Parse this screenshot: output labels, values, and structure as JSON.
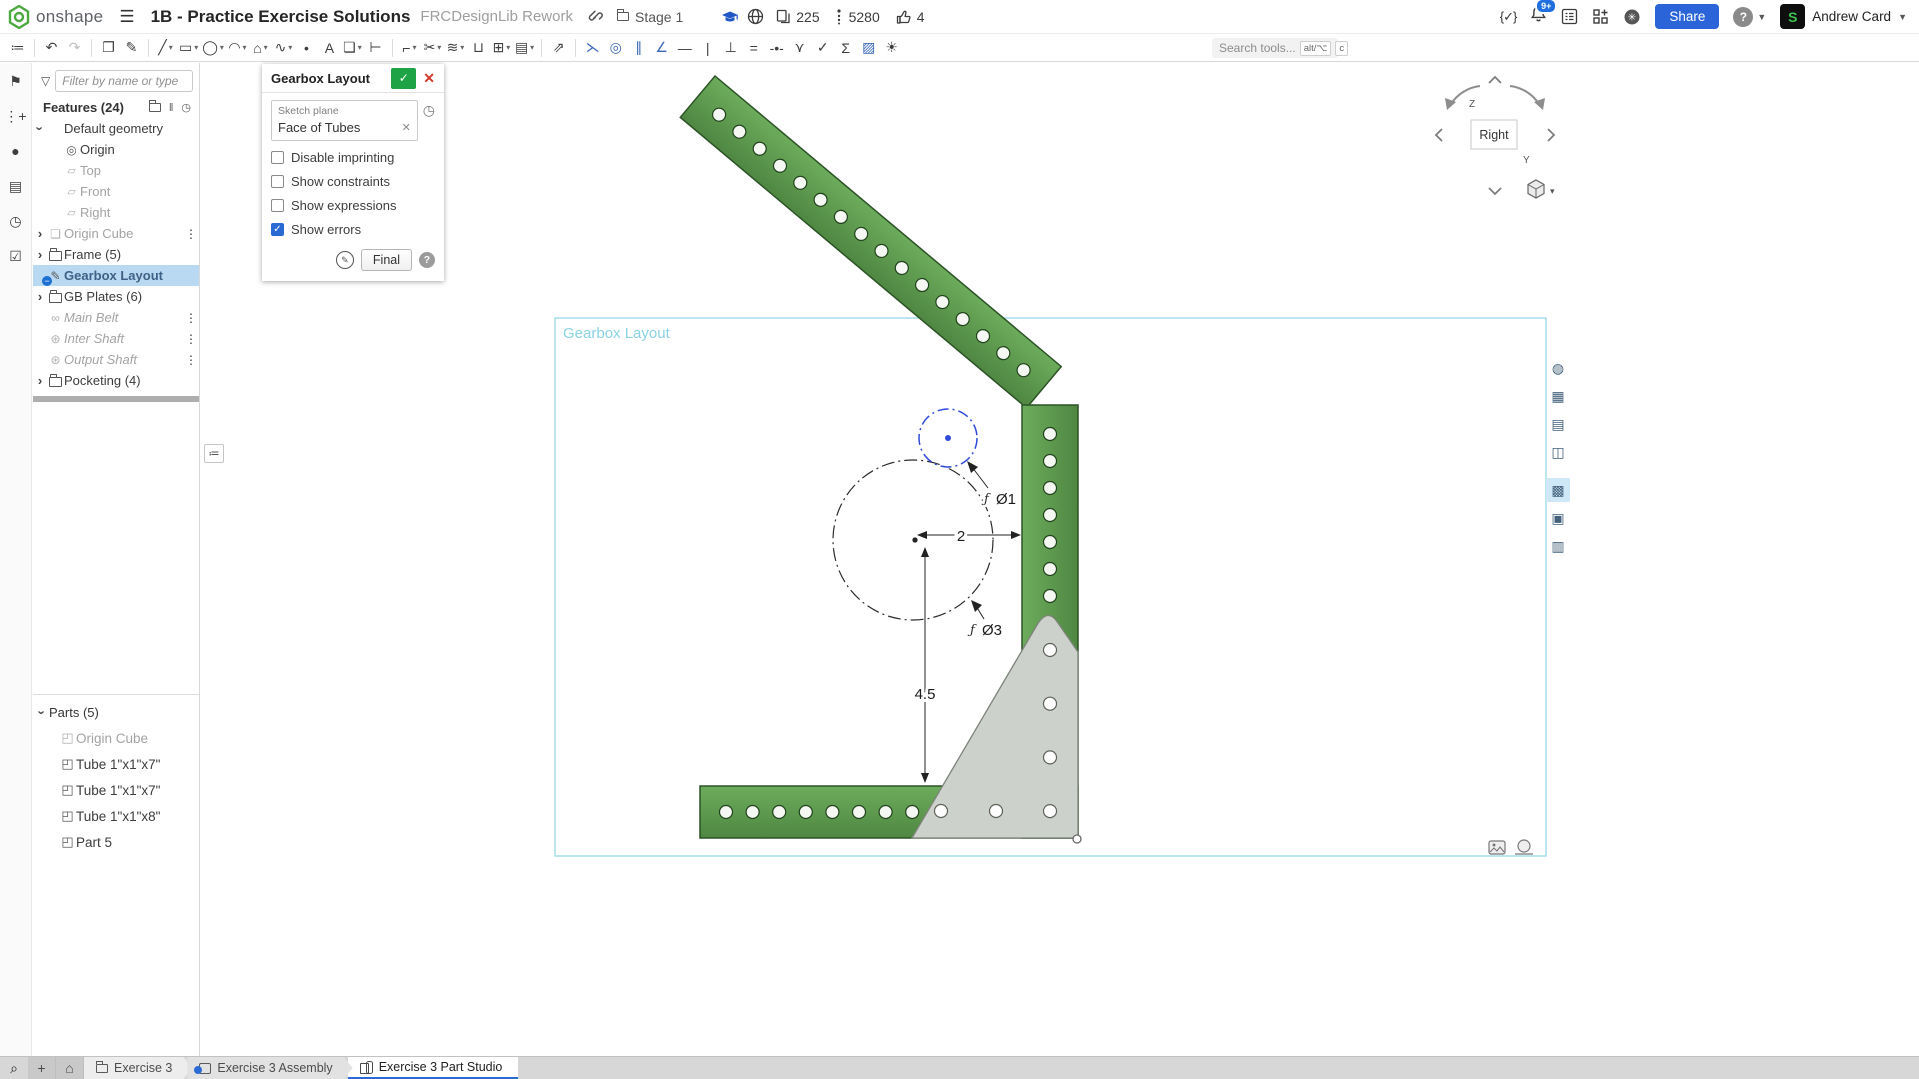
{
  "header": {
    "wordmark": "onshape",
    "title": "1B - Practice Exercise Solutions",
    "subtitle": "FRCDesignLib Rework",
    "folder_label": "Stage 1",
    "copies_count": "225",
    "views_count": "5280",
    "likes_count": "4",
    "featurescript_glyph": "{✓}",
    "notifications_badge": "9+",
    "share_label": "Share",
    "help_glyph": "?",
    "avatar_letter": "S",
    "user_name": "Andrew Card"
  },
  "toolbar": {
    "items": [
      {
        "name": "sketch-feature-list-icon",
        "glyph": "≔"
      },
      {
        "sep": true,
        "interactable": "false"
      },
      {
        "name": "undo-button",
        "glyph": "↶"
      },
      {
        "name": "redo-button",
        "glyph": "↷",
        "dim": true
      },
      {
        "sep": true,
        "interactable": "false"
      },
      {
        "name": "paste-sketch-icon",
        "glyph": "❐"
      },
      {
        "name": "active-sketch-icon",
        "glyph": "✎"
      },
      {
        "sep": true,
        "interactable": "false"
      },
      {
        "name": "line-tool",
        "glyph": "╱",
        "menu": true
      },
      {
        "name": "rectangle-tool",
        "glyph": "▭",
        "menu": true
      },
      {
        "name": "circle-tool",
        "glyph": "◯",
        "menu": true
      },
      {
        "name": "arc-tool",
        "glyph": "◠",
        "menu": true
      },
      {
        "name": "polygon-tool",
        "glyph": "⌂",
        "menu": true
      },
      {
        "name": "spline-tool",
        "glyph": "∿",
        "menu": true
      },
      {
        "name": "point-tool",
        "glyph": "•"
      },
      {
        "name": "text-tool",
        "glyph": "A"
      },
      {
        "name": "use-project-tool",
        "glyph": "❏",
        "menu": true
      },
      {
        "name": "dimension-tool",
        "glyph": "⊢"
      },
      {
        "sep": true,
        "interactable": "false"
      },
      {
        "name": "fillet-tool",
        "glyph": "⌐",
        "menu": true
      },
      {
        "name": "trim-tool",
        "glyph": "✂",
        "menu": true
      },
      {
        "name": "offset-tool",
        "glyph": "≋",
        "menu": true
      },
      {
        "name": "slot-tool",
        "glyph": "⊔"
      },
      {
        "name": "sketch-pattern-tool",
        "glyph": "⊞",
        "menu": true
      },
      {
        "name": "import-dxf-tool",
        "glyph": "▤",
        "menu": true
      },
      {
        "sep": true,
        "interactable": "false"
      },
      {
        "name": "transform-tool",
        "glyph": "⇗"
      },
      {
        "sep": true,
        "interactable": "false"
      },
      {
        "name": "coincident-constraint",
        "glyph": "⋋",
        "blue": true
      },
      {
        "name": "concentric-constraint",
        "glyph": "◎",
        "blue": true
      },
      {
        "name": "parallel-constraint",
        "glyph": "∥",
        "blue": true
      },
      {
        "name": "tangent-constraint",
        "glyph": "∠",
        "blue": true
      },
      {
        "name": "horizontal-constraint",
        "glyph": "—"
      },
      {
        "name": "vertical-constraint",
        "glyph": "|"
      },
      {
        "name": "perpendicular-constraint",
        "glyph": "⊥"
      },
      {
        "name": "equal-constraint",
        "glyph": "="
      },
      {
        "name": "midpoint-constraint",
        "glyph": "-•-"
      },
      {
        "name": "symmetric-constraint",
        "glyph": "⋎"
      },
      {
        "name": "normal-constraint",
        "glyph": "✓"
      },
      {
        "name": "sketch-expressions-icon",
        "glyph": "Σ"
      },
      {
        "name": "hatch-fill-icon",
        "glyph": "▨",
        "blue": true
      },
      {
        "name": "curvature-visualization-icon",
        "glyph": "☀"
      }
    ],
    "search_label": "Search tools...",
    "search_keys": [
      "alt/⌥",
      "c"
    ]
  },
  "left_rail": {
    "items": [
      {
        "name": "versions-icon",
        "glyph": "⚑"
      },
      {
        "name": "follow-mode-icon",
        "glyph": "⋮+"
      },
      {
        "name": "comments-icon",
        "glyph": "●"
      },
      {
        "name": "notes-icon",
        "glyph": "▤"
      },
      {
        "name": "stopwatch-icon",
        "glyph": "◷"
      },
      {
        "name": "tasks-icon",
        "glyph": "☑"
      }
    ]
  },
  "feature_panel": {
    "filter_placeholder": "Filter by name or type",
    "features_title": "Features (24)",
    "tree": [
      {
        "label": "Default geometry",
        "expander": "down",
        "icon": "none",
        "indent": "0"
      },
      {
        "label": "Origin",
        "icon": "origin",
        "indent": "1"
      },
      {
        "label": "Top",
        "icon": "plane",
        "indent": "1",
        "state": "dim"
      },
      {
        "label": "Front",
        "icon": "plane",
        "indent": "1",
        "state": "dim"
      },
      {
        "label": "Right",
        "icon": "plane",
        "indent": "1",
        "state": "dim"
      },
      {
        "label": "Origin Cube",
        "icon": "cube",
        "expander": "right",
        "state": "dim",
        "dots": "true",
        "indent": "0"
      },
      {
        "label": "Frame (5)",
        "icon": "folder",
        "expander": "right",
        "indent": "0"
      },
      {
        "label": "Gearbox Layout",
        "icon": "sketch",
        "selected": "true",
        "badge": "minus",
        "indent": "0"
      },
      {
        "label": "GB Plates (6)",
        "icon": "folder",
        "expander": "right",
        "indent": "0"
      },
      {
        "label": "Main Belt",
        "icon": "belt",
        "state": "dim",
        "italic": "true",
        "dots": "true",
        "indent": "0"
      },
      {
        "label": "Inter Shaft",
        "icon": "gear",
        "state": "dim",
        "italic": "true",
        "dots": "true",
        "indent": "0"
      },
      {
        "label": "Output Shaft",
        "icon": "gear",
        "state": "dim",
        "italic": "true",
        "dots": "true",
        "indent": "0"
      },
      {
        "label": "Pocketing (4)",
        "icon": "folder",
        "expander": "right",
        "indent": "0"
      }
    ],
    "parts_title": "Parts (5)",
    "parts": [
      {
        "label": "Origin Cube",
        "icon": "part",
        "state": "dim"
      },
      {
        "label": "Tube 1\"x1\"x7\"",
        "icon": "part"
      },
      {
        "label": "Tube 1\"x1\"x7\"",
        "icon": "part"
      },
      {
        "label": "Tube 1\"x1\"x8\"",
        "icon": "part"
      },
      {
        "label": "Part 5",
        "icon": "part"
      }
    ]
  },
  "dialog": {
    "title": "Gearbox Layout",
    "sketch_plane_label": "Sketch plane",
    "sketch_plane_value": "Face of Tubes",
    "checkboxes": [
      {
        "label": "Disable imprinting",
        "checked": "false"
      },
      {
        "label": "Show constraints",
        "checked": "false"
      },
      {
        "label": "Show expressions",
        "checked": "false"
      },
      {
        "label": "Show errors",
        "checked": "true"
      }
    ],
    "final_label": "Final",
    "help_glyph": "?"
  },
  "canvas": {
    "sketch_label": "Gearbox Layout",
    "dim_width": "2",
    "dim_height": "4.5",
    "dim_d1_prefix": "ƒ",
    "dim_d1": "Ø1",
    "dim_d3_prefix": "ƒ",
    "dim_d3": "Ø3",
    "view_label": "Right",
    "axis_z": "Z",
    "axis_y": "Y",
    "colors": {
      "tube_green": "#5b9a4e",
      "gusset_gray": "#cdd1cc",
      "sketch_frame": "#a6dde9",
      "selection_blue": "#2f4bd7"
    }
  },
  "right_rail": {
    "items": [
      {
        "name": "render-options-panel-icon",
        "glyph": "◍"
      },
      {
        "name": "named-views-panel-icon",
        "glyph": "▦"
      },
      {
        "name": "display-states-panel-icon",
        "glyph": "▤"
      },
      {
        "name": "section-view-panel-icon",
        "glyph": "◫"
      },
      {
        "name": "performance-panel-icon",
        "glyph": "▩",
        "selected": "true",
        "gap": "true"
      },
      {
        "name": "appearances-panel-icon",
        "glyph": "▣"
      },
      {
        "name": "tables-panel-icon",
        "glyph": "▥"
      }
    ]
  },
  "bottom_bar": {
    "tabs": [
      {
        "name": "tab-exercise-3",
        "label": "Exercise 3",
        "icon": "folder"
      },
      {
        "name": "tab-exercise-3-assembly",
        "label": "Exercise 3 Assembly",
        "icon": "assembly"
      },
      {
        "name": "tab-exercise-3-part-studio",
        "label": "Exercise 3 Part Studio",
        "icon": "partstudio",
        "active": "true"
      }
    ]
  }
}
